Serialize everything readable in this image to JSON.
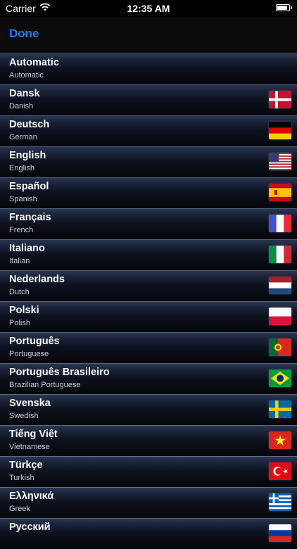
{
  "status": {
    "carrier": "Carrier",
    "time": "12:35 AM"
  },
  "nav": {
    "done_label": "Done"
  },
  "languages": [
    {
      "name": "Automatic",
      "sub": "Automatic",
      "flag": "none"
    },
    {
      "name": "Dansk",
      "sub": "Danish",
      "flag": "denmark-flag-icon"
    },
    {
      "name": "Deutsch",
      "sub": "German",
      "flag": "germany-flag-icon"
    },
    {
      "name": "English",
      "sub": "English",
      "flag": "usa-flag-icon"
    },
    {
      "name": "Español",
      "sub": "Spanish",
      "flag": "spain-flag-icon"
    },
    {
      "name": "Français",
      "sub": "French",
      "flag": "france-flag-icon"
    },
    {
      "name": "Italiano",
      "sub": "Italian",
      "flag": "italy-flag-icon"
    },
    {
      "name": "Nederlands",
      "sub": "Dutch",
      "flag": "netherlands-flag-icon"
    },
    {
      "name": "Polski",
      "sub": "Polish",
      "flag": "poland-flag-icon"
    },
    {
      "name": "Português",
      "sub": "Portuguese",
      "flag": "portugal-flag-icon"
    },
    {
      "name": "Português Brasileiro",
      "sub": "Brazilian Portuguese",
      "flag": "brazil-flag-icon"
    },
    {
      "name": "Svenska",
      "sub": "Swedish",
      "flag": "sweden-flag-icon"
    },
    {
      "name": "Tiếng Việt",
      "sub": "Vietnamese",
      "flag": "vietnam-flag-icon"
    },
    {
      "name": "Türkçe",
      "sub": "Turkish",
      "flag": "turkey-flag-icon"
    },
    {
      "name": "Ελληνικά",
      "sub": "Greek",
      "flag": "greece-flag-icon"
    },
    {
      "name": "Русский",
      "sub": "",
      "flag": "russia-flag-icon"
    }
  ]
}
